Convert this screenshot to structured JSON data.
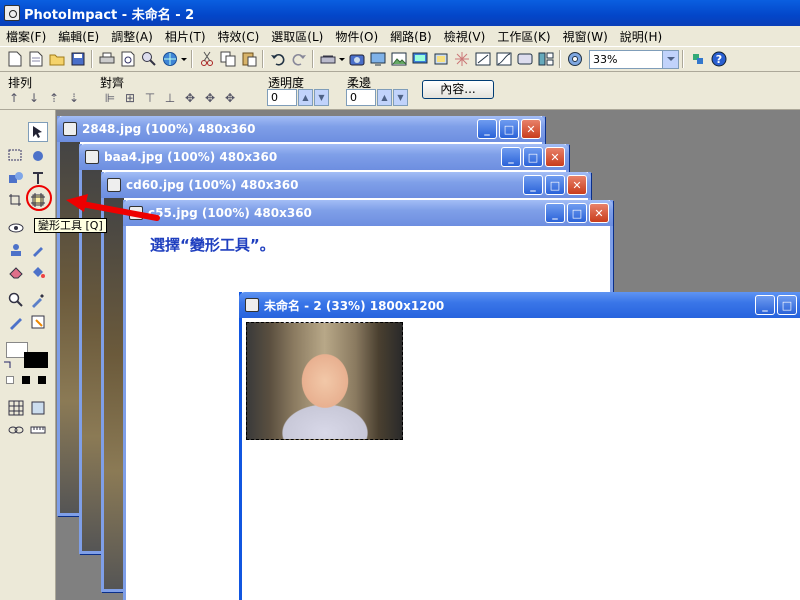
{
  "app": {
    "title": "PhotoImpact - 未命名 - 2"
  },
  "menu": [
    "檔案(F)",
    "編輯(E)",
    "調整(A)",
    "相片(T)",
    "特效(C)",
    "選取區(L)",
    "物件(O)",
    "網路(B)",
    "檢視(V)",
    "工作區(K)",
    "視窗(W)",
    "說明(H)"
  ],
  "toolbar": {
    "zoom_value": "33%"
  },
  "attrbar": {
    "arrange_label": "排列",
    "align_label": "對齊",
    "transparency_label": "透明度",
    "transparency_value": "0",
    "soft_edge_label": "柔邊",
    "soft_edge_value": "0",
    "properties_button": "內容..."
  },
  "tooltip": "變形工具 [Q]",
  "instruction": "選擇“變形工具”。",
  "documents": [
    {
      "title": "2848.jpg (100%) 480x360"
    },
    {
      "title": "baa4.jpg (100%) 480x360"
    },
    {
      "title": "cd60.jpg (100%) 480x360"
    },
    {
      "title": "c55.jpg (100%) 480x360"
    },
    {
      "title": "未命名 - 2 (33%) 1800x1200"
    }
  ],
  "colors": {
    "annotation": "#e00000",
    "instruction_text": "#1f3fbf",
    "title_active": "#0346c9"
  }
}
